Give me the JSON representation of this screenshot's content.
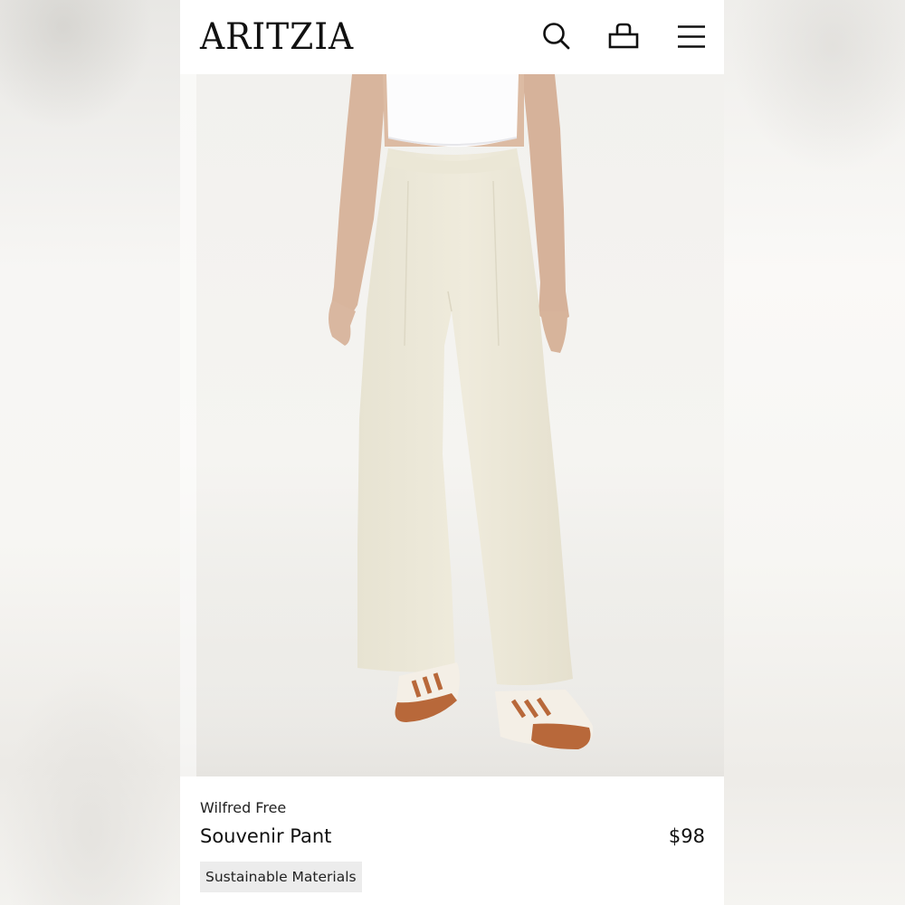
{
  "header": {
    "logo_text": "ARITZIA",
    "icons": [
      "search-icon",
      "shopping-bag-icon",
      "menu-icon"
    ]
  },
  "product_image": {
    "description_icon": "product-photo"
  },
  "product": {
    "brand": "Wilfred Free",
    "name": "Souvenir Pant",
    "price": "$98",
    "badge": "Sustainable Materials"
  },
  "colors": {
    "text": "#111111",
    "badge_bg": "#ececec",
    "pant": "#ece8d8",
    "sneaker_accent": "#b8683a"
  }
}
